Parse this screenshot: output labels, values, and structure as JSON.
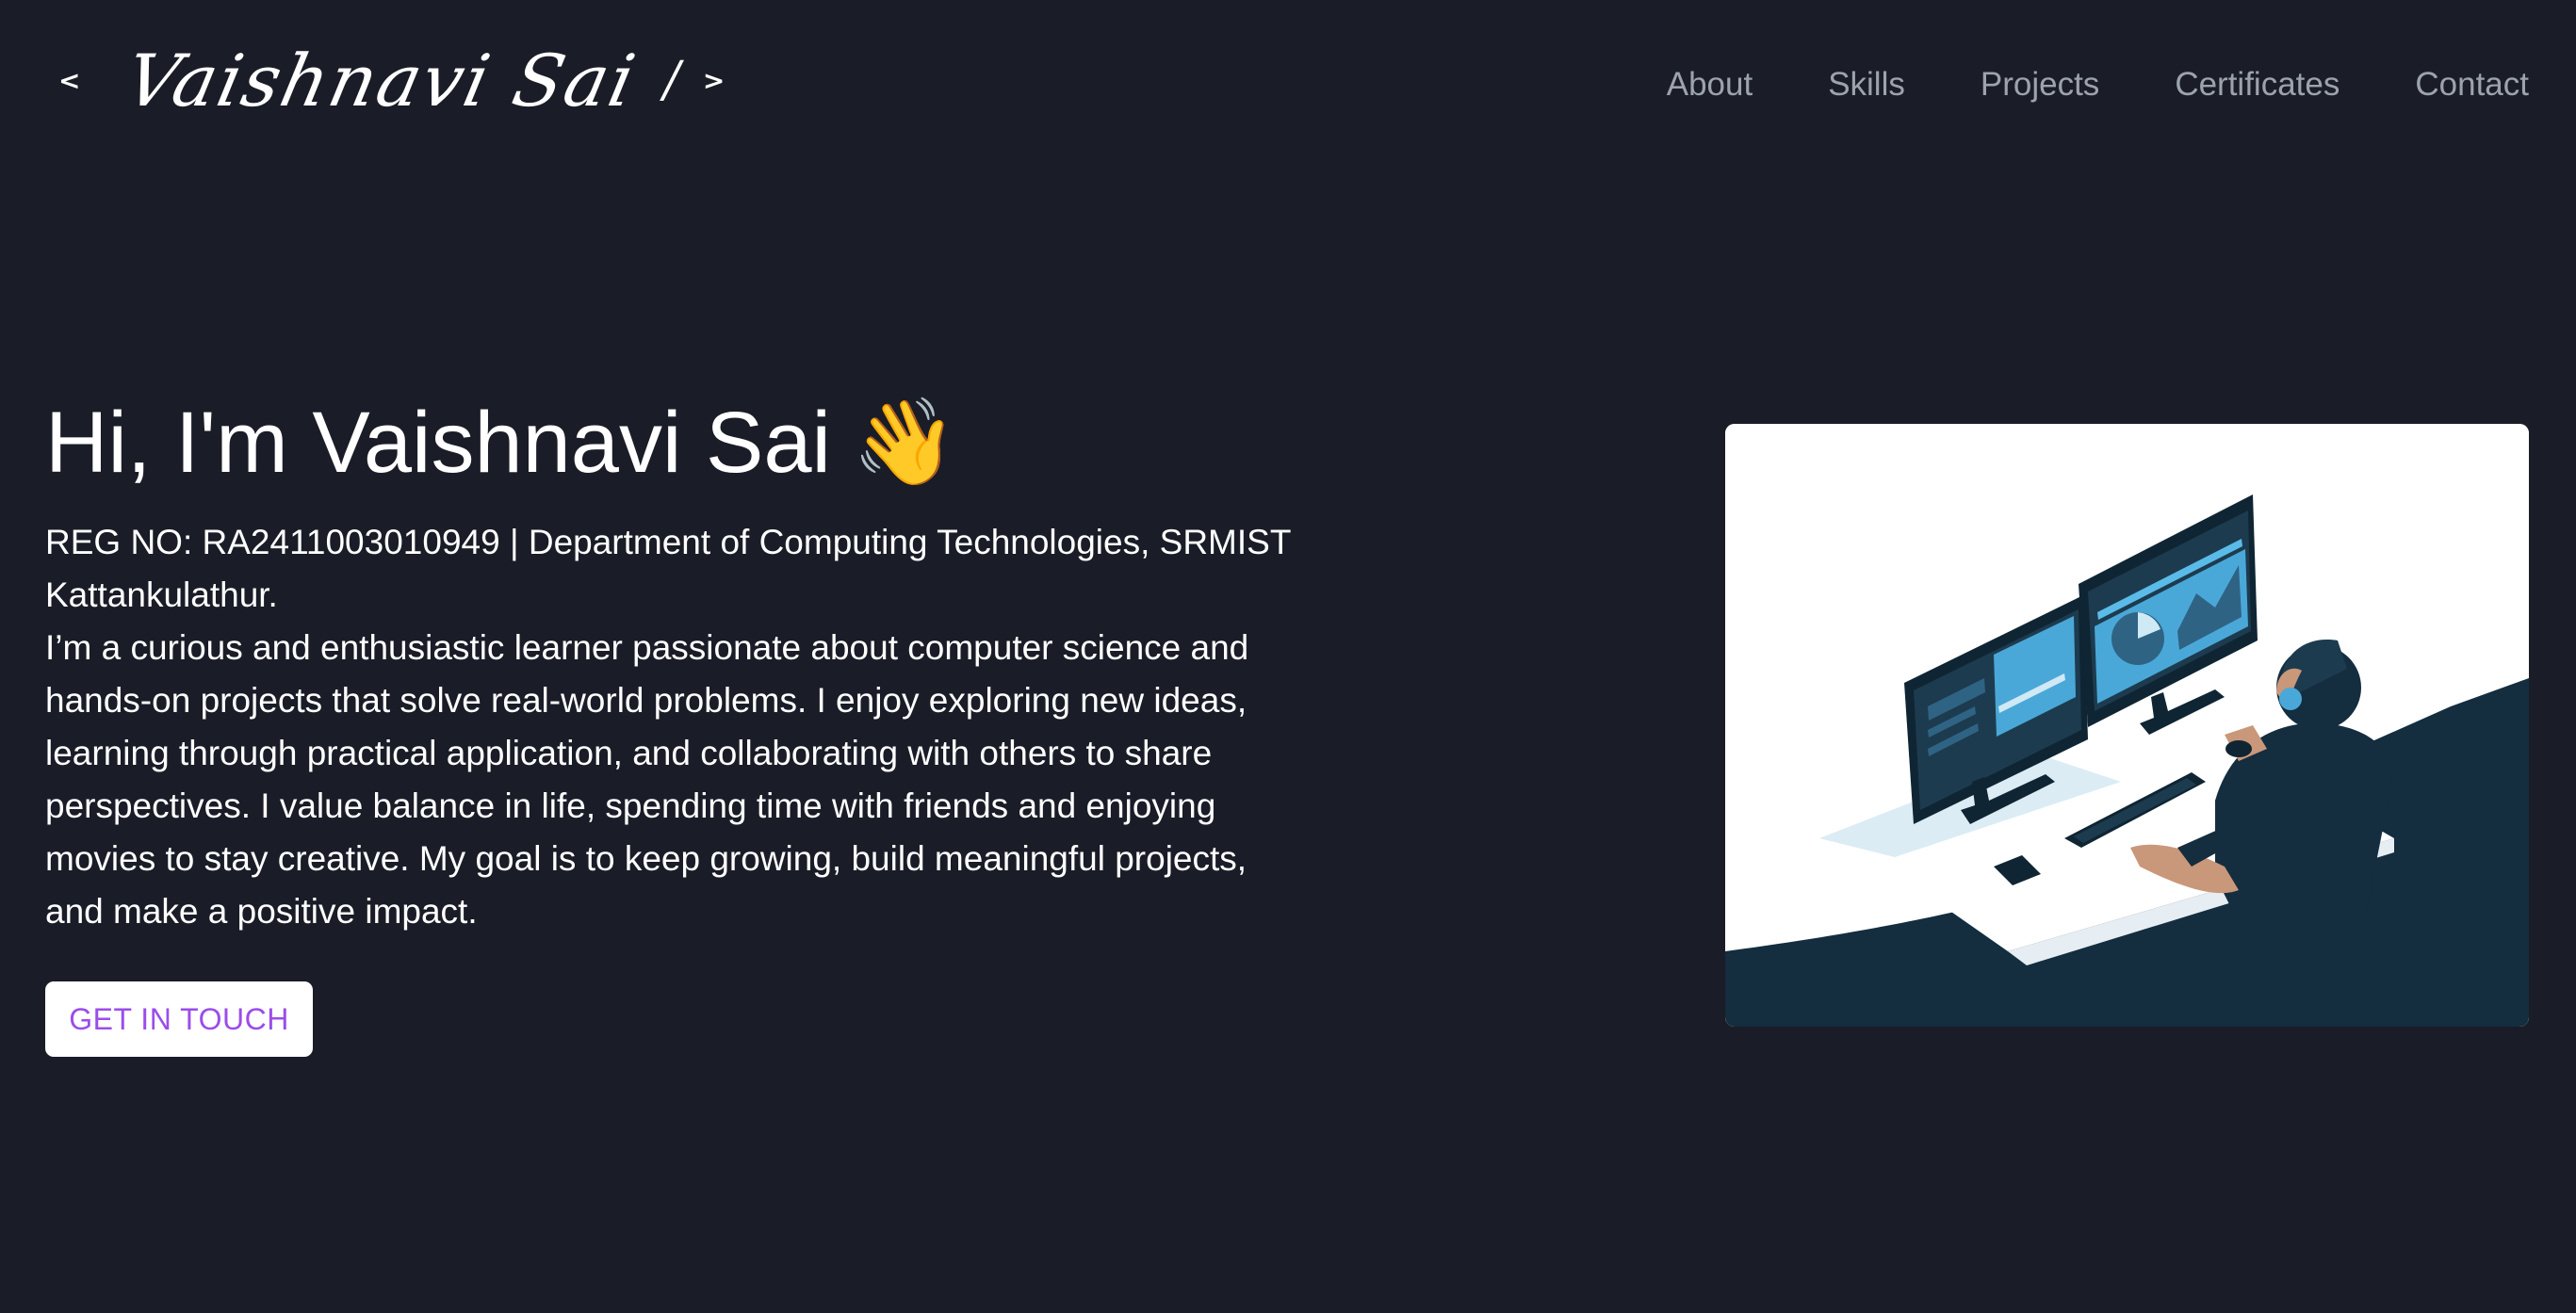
{
  "logo": {
    "open_bracket": "<",
    "name": "Vaishnavi Sai",
    "slash": "/",
    "close_bracket": ">"
  },
  "nav": {
    "items": [
      {
        "label": "About"
      },
      {
        "label": "Skills"
      },
      {
        "label": "Projects"
      },
      {
        "label": "Certificates"
      },
      {
        "label": "Contact"
      }
    ]
  },
  "hero": {
    "title": "Hi, I'm Vaishnavi Sai",
    "wave_emoji": "👋",
    "reg_line": "REG NO: RA2411003010949 | Department of Computing Technologies, SRMIST Kattankulathur.",
    "bio": "I’m a curious and enthusiastic learner passionate about computer science and hands-on projects that solve real-world problems. I enjoy exploring new ideas, learning through practical application, and collaborating with others to share perspectives. I value balance in life, spending time with friends and enjoying movies to stay creative. My goal is to keep growing, build meaningful projects, and make a positive impact.",
    "cta_label": "GET IN TOUCH"
  },
  "colors": {
    "background": "#1a1d27",
    "nav_text": "#9ca3af",
    "text": "#ffffff",
    "accent": "#9b4dea",
    "illustration_dark": "#142d3f",
    "illustration_screen": "#4aa8d8"
  },
  "icons": {
    "wave": "waving-hand-icon",
    "illustration": "developer-at-desk-illustration"
  }
}
